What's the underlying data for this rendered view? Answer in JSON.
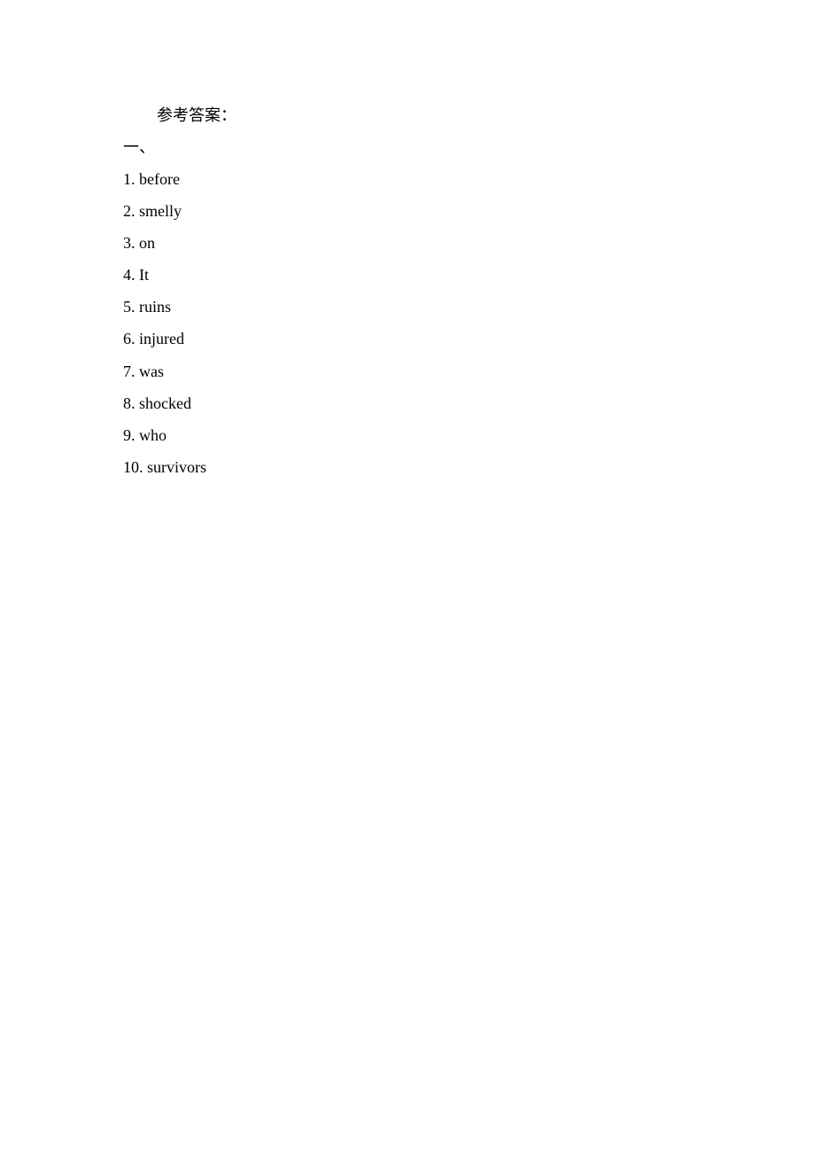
{
  "document": {
    "heading": "参考答案：",
    "section_label": "一、",
    "answers": [
      "1. before",
      "2. smelly",
      "3. on",
      "4. It",
      "5. ruins",
      "6. injured",
      "7. was",
      "8. shocked",
      "9. who",
      "10. survivors"
    ]
  }
}
